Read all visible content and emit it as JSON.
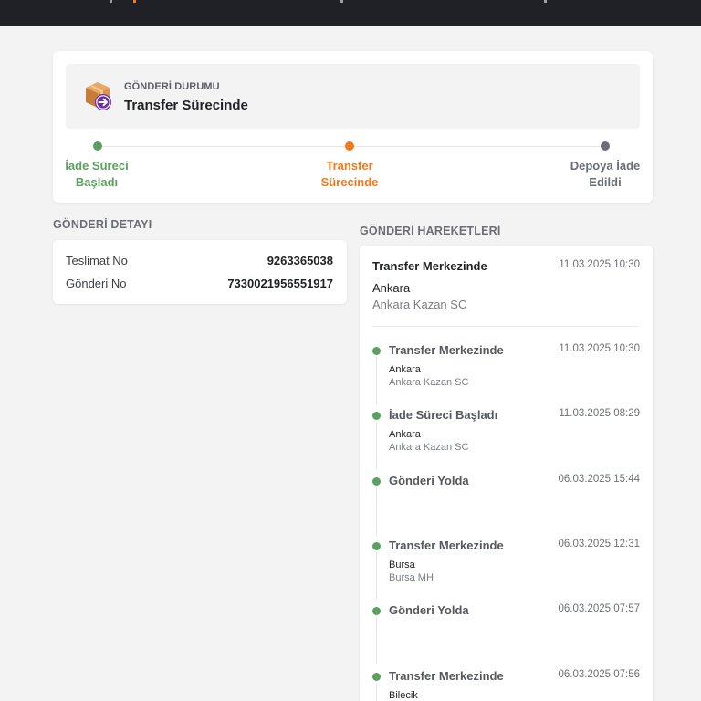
{
  "colors": {
    "accent": "#f27a1a",
    "done": "#5aa05e",
    "pending": "#6b6f75",
    "header_bg": "#1f2127"
  },
  "status": {
    "label": "GÖNDERİ DURUMU",
    "value": "Transfer Sürecinde",
    "icon": "package-return-icon"
  },
  "progress": {
    "steps": [
      {
        "line1": "İade Süreci",
        "line2": "Başladı",
        "state": "done"
      },
      {
        "line1": "Transfer",
        "line2": "Sürecinde",
        "state": "current"
      },
      {
        "line1": "Depoya İade",
        "line2": "Edildi",
        "state": "pending"
      }
    ]
  },
  "detail": {
    "title": "GÖNDERİ DETAYI",
    "rows": [
      {
        "key": "Teslimat No",
        "value": "9263365038"
      },
      {
        "key": "Gönderi No",
        "value": "7330021956551917"
      }
    ]
  },
  "moves": {
    "title": "GÖNDERİ HAREKETLERİ",
    "latest": {
      "title": "Transfer Merkezinde",
      "time": "11.03.2025 10:30",
      "city": "Ankara",
      "branch": "Ankara Kazan SC"
    },
    "items": [
      {
        "title": "Transfer Merkezinde",
        "time": "11.03.2025 10:30",
        "city": "Ankara",
        "branch": "Ankara Kazan SC"
      },
      {
        "title": "İade Süreci Başladı",
        "time": "11.03.2025 08:29",
        "city": "Ankara",
        "branch": "Ankara Kazan SC"
      },
      {
        "title": "Gönderi Yolda",
        "time": "06.03.2025 15:44",
        "city": "",
        "branch": ""
      },
      {
        "title": "Transfer Merkezinde",
        "time": "06.03.2025 12:31",
        "city": "Bursa",
        "branch": "Bursa MH"
      },
      {
        "title": "Gönderi Yolda",
        "time": "06.03.2025 07:57",
        "city": "",
        "branch": ""
      },
      {
        "title": "Transfer Merkezinde",
        "time": "06.03.2025 07:56",
        "city": "Bilecik",
        "branch": ""
      }
    ]
  }
}
